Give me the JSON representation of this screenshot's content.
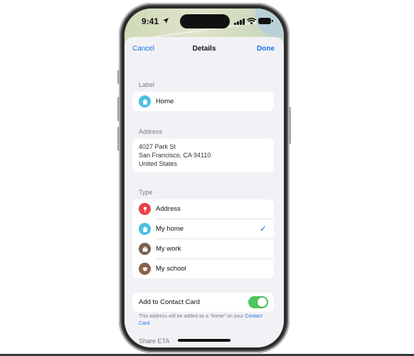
{
  "status_bar": {
    "time": "9:41"
  },
  "nav": {
    "cancel": "Cancel",
    "title": "Details",
    "done": "Done"
  },
  "label_section": {
    "header": "Label",
    "value": "Home"
  },
  "address_section": {
    "header": "Address",
    "lines": [
      "4027 Park St",
      "San Francisco, CA  94110",
      "United States"
    ]
  },
  "type_section": {
    "header": "Type",
    "options": [
      {
        "label": "Address",
        "icon": "pin-icon",
        "color": "#e8424a",
        "selected": false
      },
      {
        "label": "My home",
        "icon": "house-icon",
        "color": "#4bbfe0",
        "selected": true
      },
      {
        "label": "My work",
        "icon": "briefcase-icon",
        "color": "#7e5f4c",
        "selected": false
      },
      {
        "label": "My school",
        "icon": "graduation-cap-icon",
        "color": "#8a6248",
        "selected": false
      }
    ],
    "check_mark": "✓"
  },
  "contact": {
    "label": "Add to Contact Card",
    "enabled": true,
    "note_text": "This address will be added as a “home” on your",
    "note_link": "Contact Card",
    "note_end": "."
  },
  "share_eta": {
    "header": "Share ETA"
  },
  "colors": {
    "accent": "#1a73e8",
    "toggle_on": "#4cc65d",
    "home_icon": "#4bbfe0"
  }
}
